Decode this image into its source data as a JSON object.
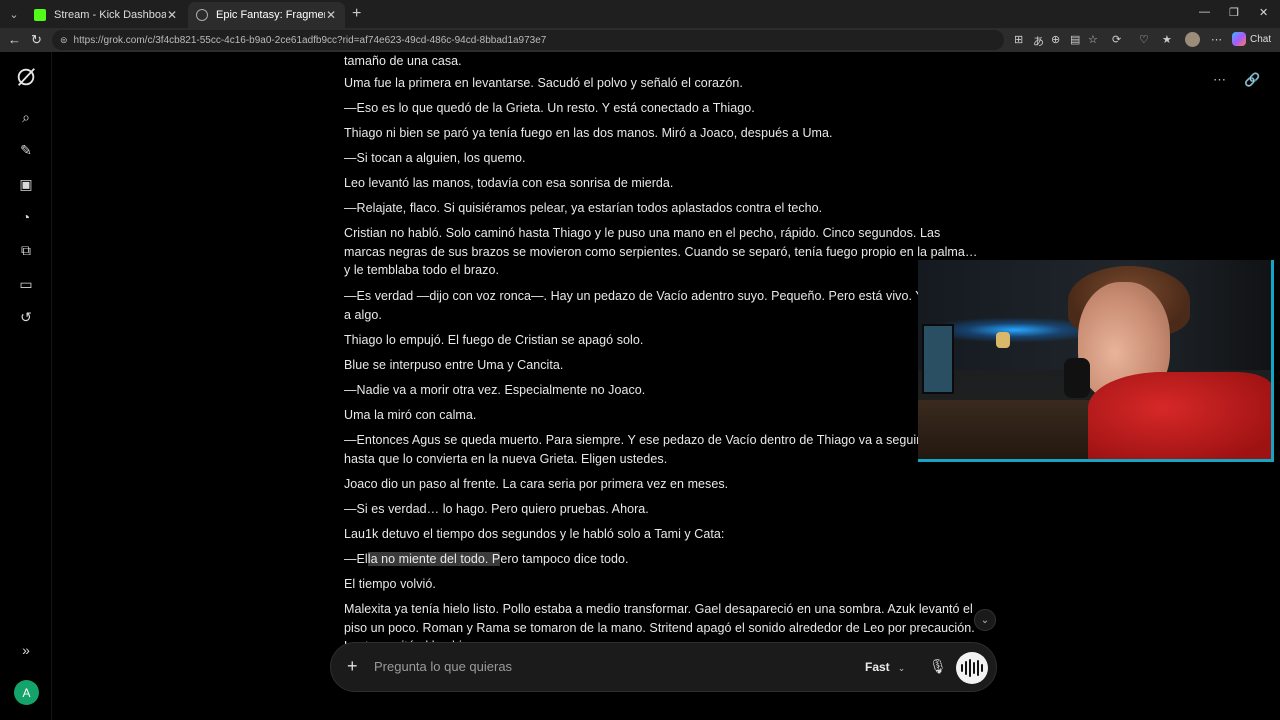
{
  "browser": {
    "tabs": [
      {
        "title": "Stream - Kick Dashboard",
        "favicon_color": "#53fc18"
      },
      {
        "title": "Epic Fantasy: Fragmentos and Fort",
        "favicon_color": "#888888"
      }
    ],
    "url": "https://grok.com/c/3f4cb821-55cc-4c16-b9a0-2ce61adfb9cc?rid=af74e623-49cd-486c-94cd-8bbad1a973e7",
    "chat_button_label": "Chat"
  },
  "sidebar": {
    "avatar_initial": "A"
  },
  "story": {
    "paragraphs": [
      "tamaño de una casa.",
      "Uma fue la primera en levantarse. Sacudó el polvo y señaló el corazón.",
      "—Eso es lo que quedó de la Grieta. Un resto. Y está conectado a Thiago.",
      "Thiago ni bien se paró ya tenía fuego en las dos manos. Miró a Joaco, después a Uma.",
      "—Si tocan a alguien, los quemo.",
      "Leo levantó las manos, todavía con esa sonrisa de mierda.",
      "—Relajate, flaco. Si quisiéramos pelear, ya estarían todos aplastados contra el techo.",
      "Cristian no habló. Solo caminó hasta Thiago y le puso una mano en el pecho, rápido. Cinco segundos. Las marcas negras de sus brazos se movieron como serpientes. Cuando se separó, tenía fuego propio en la palma… y le temblaba todo el brazo.",
      "—Es verdad —dijo con voz ronca—. Hay un pedazo de Vacío adentro suyo. Pequeño. Pero está vivo. Y llamando a algo.",
      "Thiago lo empujó. El fuego de Cristian se apagó solo.",
      "Blue se interpuso entre Uma y Cancita.",
      "—Nadie va a morir otra vez. Especialmente no Joaco.",
      "Uma la miró con calma.",
      "—Entonces Agus se queda muerto. Para siempre. Y ese pedazo de Vacío dentro de Thiago va a seguir creciendo hasta que lo convierta en la nueva Grieta. Eligen ustedes.",
      "Joaco dio un paso al frente. La cara seria por primera vez en meses.",
      "—Si es verdad… lo hago. Pero quiero pruebas. Ahora.",
      "Lau1k detuvo el tiempo dos segundos y le habló solo a Tami y Cata:",
      "El tiempo volvió.",
      "Malexita ya tenía hielo listo. Pollo estaba a medio transformar. Gael desapareció en una sombra. Azuk levantó el piso un poco. Roman y Rama se tomaron de la mano. Stritend apagó el sonido alrededor de Leo por precaución. Lautaro gritó el hechizo."
    ],
    "selected_line": {
      "before": "—El",
      "selected": "la no miente del todo. P",
      "after": "ero tampoco dice todo."
    }
  },
  "composer": {
    "placeholder": "Pregunta lo que quieras",
    "mode": "Fast"
  },
  "colors": {
    "webcam_border": "#12a6c4",
    "avatar_bg": "#14a36a"
  }
}
